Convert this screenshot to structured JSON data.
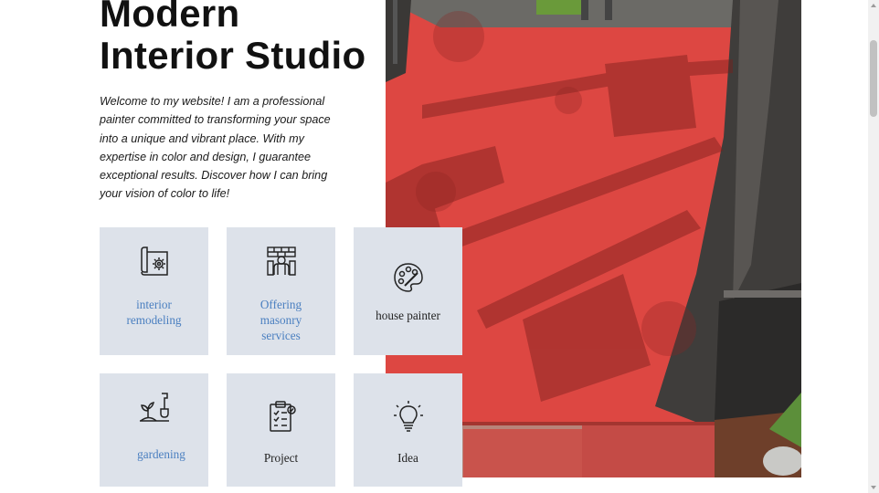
{
  "hero": {
    "title_line1": "Modern",
    "title_line2": "Interior Studio",
    "intro": "Welcome to my website! I am a professional painter committed to transforming your space into a unique and vibrant place. With my expertise in color and design, I guarantee exceptional results. Discover how I can bring your vision of color to life!"
  },
  "services": [
    {
      "label": "interior remodeling",
      "linked": true,
      "icon": "blueprint-gear-icon"
    },
    {
      "label": "Offering masonry services",
      "linked": true,
      "icon": "bricklayer-worker-icon"
    },
    {
      "label": "house painter",
      "linked": false,
      "icon": "paint-palette-icon"
    },
    {
      "label": "gardening",
      "linked": true,
      "icon": "shovel-plant-icon"
    },
    {
      "label": "Project",
      "linked": false,
      "icon": "clipboard-checklist-icon"
    },
    {
      "label": "Idea",
      "linked": false,
      "icon": "lightbulb-icon"
    }
  ],
  "colors": {
    "card_bg": "#dde2ea",
    "link": "#4a7fc0",
    "floor_red": "#d8413c",
    "frame_gray": "#3f3d3b"
  },
  "photo": {
    "subject": "red painted patio floor inside screened enclosure"
  }
}
